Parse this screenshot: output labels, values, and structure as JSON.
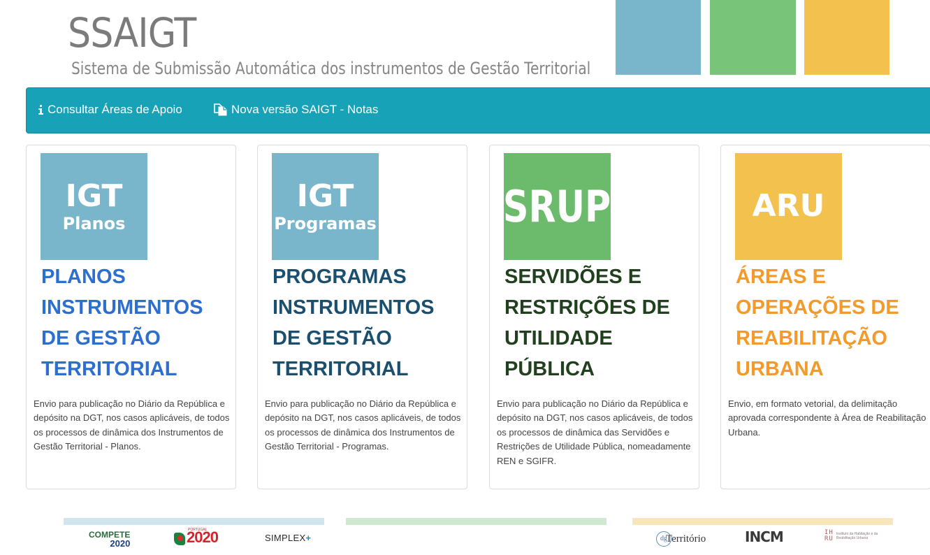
{
  "header": {
    "title": "SSAIGT",
    "subtitle": "Sistema de  Submissão Automática dos instrumentos de Gestão Territorial",
    "colors": {
      "blue": "#7ab6cb",
      "green": "#78c57a",
      "yellow": "#f2c14e"
    }
  },
  "nav": {
    "background": "#17a2b8",
    "items": [
      {
        "icon": "info-icon",
        "label": "Consultar Áreas de Apoio"
      },
      {
        "icon": "documents-icon",
        "label": "Nova versão SAIGT - Notas"
      }
    ]
  },
  "cards": [
    {
      "tile": {
        "line1": "IGT",
        "line2": "Planos",
        "color": "#7ab6cb"
      },
      "heading": "PLANOS INSTRUMENTOS DE GESTÃO TERRITORIAL",
      "heading_color": "#2d6fce",
      "description": "Envio para publicação no Diário da República e depósito na DGT, nos casos aplicáveis, de todos os processos de dinâmica dos Instrumentos de Gestão Territorial - Planos."
    },
    {
      "tile": {
        "line1": "IGT",
        "line2": "Programas",
        "color": "#7ab6cb"
      },
      "heading": "PROGRAMAS INSTRUMENTOS DE GESTÃO TERRITORIAL",
      "heading_color": "#1b4f6f",
      "description": "Envio para publicação no Diário da República e depósito na DGT, nos casos aplicáveis, de todos os processos de dinâmica dos Instrumentos de Gestão Territorial - Programas."
    },
    {
      "tile": {
        "line1": "SRUP",
        "color": "#6cbb6c"
      },
      "heading": "SERVIDÕES E RESTRIÇÕES DE UTILIDADE PÚBLICA",
      "heading_color": "#20401e",
      "description": "Envio para publicação no Diário da República e depósito na DGT, nos casos aplicáveis, de todos os processos de dinâmica das Servidões e Restrições de Utilidade Pública, nomeadamente REN e SGIFR."
    },
    {
      "tile": {
        "line1": "ARU",
        "color": "#f2c14e"
      },
      "heading": "ÁREAS E OPERAÇÕES DE REABILITAÇÃO URBANA",
      "heading_color": "#f39a2b",
      "description": "Envio, em formato vetorial, da delimitação aprovada correspondente à Área de Reabilitação Urbana."
    }
  ],
  "footer": {
    "compete": {
      "line1": "COMPETE",
      "line2": "2020"
    },
    "portugal2020": {
      "small": "PORTUGAL",
      "big": "2020"
    },
    "simplex": {
      "text": "SIMPLEX",
      "plus": "+"
    },
    "dgt": {
      "mark": "dg",
      "text": "Território"
    },
    "incm": "INCM",
    "ihru": {
      "mark": "IH\nRU",
      "name": "Instituto da Habitação e da Reabilitação Urbana"
    }
  }
}
